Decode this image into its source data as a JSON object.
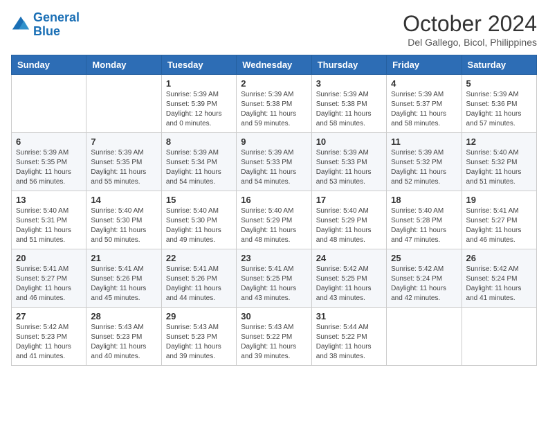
{
  "logo": {
    "line1": "General",
    "line2": "Blue"
  },
  "title": "October 2024",
  "location": "Del Gallego, Bicol, Philippines",
  "header": {
    "days": [
      "Sunday",
      "Monday",
      "Tuesday",
      "Wednesday",
      "Thursday",
      "Friday",
      "Saturday"
    ]
  },
  "weeks": [
    [
      {
        "day": "",
        "info": ""
      },
      {
        "day": "",
        "info": ""
      },
      {
        "day": "1",
        "info": "Sunrise: 5:39 AM\nSunset: 5:39 PM\nDaylight: 12 hours\nand 0 minutes."
      },
      {
        "day": "2",
        "info": "Sunrise: 5:39 AM\nSunset: 5:38 PM\nDaylight: 11 hours\nand 59 minutes."
      },
      {
        "day": "3",
        "info": "Sunrise: 5:39 AM\nSunset: 5:38 PM\nDaylight: 11 hours\nand 58 minutes."
      },
      {
        "day": "4",
        "info": "Sunrise: 5:39 AM\nSunset: 5:37 PM\nDaylight: 11 hours\nand 58 minutes."
      },
      {
        "day": "5",
        "info": "Sunrise: 5:39 AM\nSunset: 5:36 PM\nDaylight: 11 hours\nand 57 minutes."
      }
    ],
    [
      {
        "day": "6",
        "info": "Sunrise: 5:39 AM\nSunset: 5:35 PM\nDaylight: 11 hours\nand 56 minutes."
      },
      {
        "day": "7",
        "info": "Sunrise: 5:39 AM\nSunset: 5:35 PM\nDaylight: 11 hours\nand 55 minutes."
      },
      {
        "day": "8",
        "info": "Sunrise: 5:39 AM\nSunset: 5:34 PM\nDaylight: 11 hours\nand 54 minutes."
      },
      {
        "day": "9",
        "info": "Sunrise: 5:39 AM\nSunset: 5:33 PM\nDaylight: 11 hours\nand 54 minutes."
      },
      {
        "day": "10",
        "info": "Sunrise: 5:39 AM\nSunset: 5:33 PM\nDaylight: 11 hours\nand 53 minutes."
      },
      {
        "day": "11",
        "info": "Sunrise: 5:39 AM\nSunset: 5:32 PM\nDaylight: 11 hours\nand 52 minutes."
      },
      {
        "day": "12",
        "info": "Sunrise: 5:40 AM\nSunset: 5:32 PM\nDaylight: 11 hours\nand 51 minutes."
      }
    ],
    [
      {
        "day": "13",
        "info": "Sunrise: 5:40 AM\nSunset: 5:31 PM\nDaylight: 11 hours\nand 51 minutes."
      },
      {
        "day": "14",
        "info": "Sunrise: 5:40 AM\nSunset: 5:30 PM\nDaylight: 11 hours\nand 50 minutes."
      },
      {
        "day": "15",
        "info": "Sunrise: 5:40 AM\nSunset: 5:30 PM\nDaylight: 11 hours\nand 49 minutes."
      },
      {
        "day": "16",
        "info": "Sunrise: 5:40 AM\nSunset: 5:29 PM\nDaylight: 11 hours\nand 48 minutes."
      },
      {
        "day": "17",
        "info": "Sunrise: 5:40 AM\nSunset: 5:29 PM\nDaylight: 11 hours\nand 48 minutes."
      },
      {
        "day": "18",
        "info": "Sunrise: 5:40 AM\nSunset: 5:28 PM\nDaylight: 11 hours\nand 47 minutes."
      },
      {
        "day": "19",
        "info": "Sunrise: 5:41 AM\nSunset: 5:27 PM\nDaylight: 11 hours\nand 46 minutes."
      }
    ],
    [
      {
        "day": "20",
        "info": "Sunrise: 5:41 AM\nSunset: 5:27 PM\nDaylight: 11 hours\nand 46 minutes."
      },
      {
        "day": "21",
        "info": "Sunrise: 5:41 AM\nSunset: 5:26 PM\nDaylight: 11 hours\nand 45 minutes."
      },
      {
        "day": "22",
        "info": "Sunrise: 5:41 AM\nSunset: 5:26 PM\nDaylight: 11 hours\nand 44 minutes."
      },
      {
        "day": "23",
        "info": "Sunrise: 5:41 AM\nSunset: 5:25 PM\nDaylight: 11 hours\nand 43 minutes."
      },
      {
        "day": "24",
        "info": "Sunrise: 5:42 AM\nSunset: 5:25 PM\nDaylight: 11 hours\nand 43 minutes."
      },
      {
        "day": "25",
        "info": "Sunrise: 5:42 AM\nSunset: 5:24 PM\nDaylight: 11 hours\nand 42 minutes."
      },
      {
        "day": "26",
        "info": "Sunrise: 5:42 AM\nSunset: 5:24 PM\nDaylight: 11 hours\nand 41 minutes."
      }
    ],
    [
      {
        "day": "27",
        "info": "Sunrise: 5:42 AM\nSunset: 5:23 PM\nDaylight: 11 hours\nand 41 minutes."
      },
      {
        "day": "28",
        "info": "Sunrise: 5:43 AM\nSunset: 5:23 PM\nDaylight: 11 hours\nand 40 minutes."
      },
      {
        "day": "29",
        "info": "Sunrise: 5:43 AM\nSunset: 5:23 PM\nDaylight: 11 hours\nand 39 minutes."
      },
      {
        "day": "30",
        "info": "Sunrise: 5:43 AM\nSunset: 5:22 PM\nDaylight: 11 hours\nand 39 minutes."
      },
      {
        "day": "31",
        "info": "Sunrise: 5:44 AM\nSunset: 5:22 PM\nDaylight: 11 hours\nand 38 minutes."
      },
      {
        "day": "",
        "info": ""
      },
      {
        "day": "",
        "info": ""
      }
    ]
  ]
}
